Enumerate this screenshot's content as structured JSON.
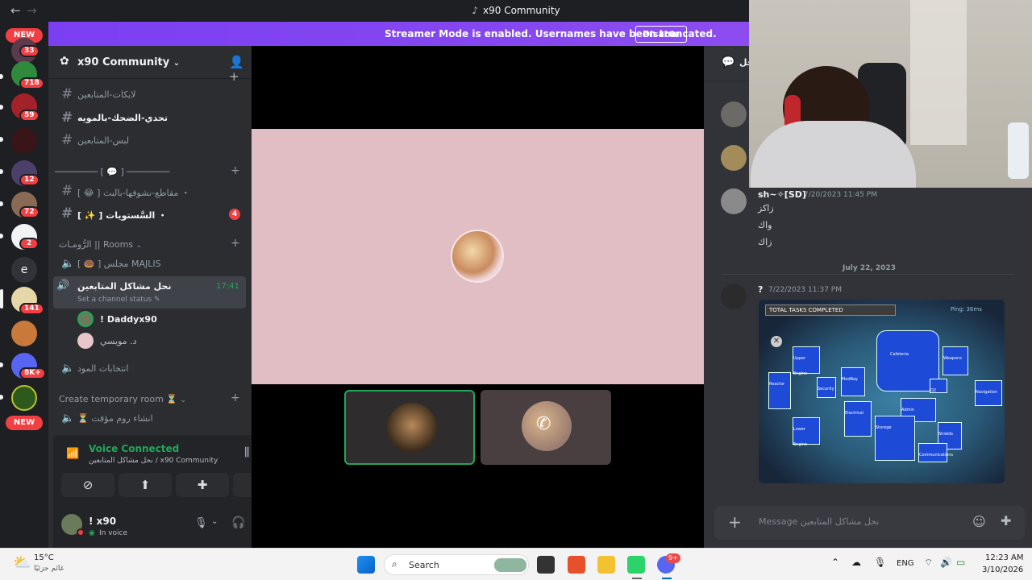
{
  "window": {
    "title": "x90 Community",
    "back": "←",
    "forward": "→"
  },
  "rail": {
    "new_label": "NEW",
    "badges": [
      "33",
      "718",
      "59",
      "12",
      "72",
      "2",
      "141",
      "8K+"
    ],
    "letter_server": "e"
  },
  "banner": {
    "message": "Streamer Mode is enabled. Usernames have been truncated.",
    "button": "Disable"
  },
  "sidebar": {
    "server_name": "x90 Community",
    "channels_top": [
      {
        "name": "لايكات-المتابعين"
      },
      {
        "name": "تحدي-الضحك-بالمويه",
        "unread": true
      },
      {
        "name": "لبس-المتابعين"
      }
    ],
    "category1": "──────── [ 💬 ] ────────",
    "channels_mid": [
      {
        "name": "[ 😂 ] مقاطع-نشوفها-بالبث ・"
      },
      {
        "name": "[ ✨ ] السَّستويات ・",
        "badge": "4",
        "unread": true
      }
    ],
    "category_rooms": "الرُّومـات || Rooms",
    "voice_channels": [
      {
        "name": "[ 🍩 ] مجلس MAJLIS"
      },
      {
        "name": "نحل مشاكل المتابعين",
        "time": "17:41",
        "status": "Set a channel status"
      }
    ],
    "members": [
      {
        "name": "! Daddyx90"
      },
      {
        "name": "د. مويسي"
      }
    ],
    "voice_channel_after": "انتخابات المود",
    "category_temp": "Create temporary room ⏳",
    "temp_channel": "⏳ انشاء روم مؤقت"
  },
  "voice_panel": {
    "status": "Voice Connected",
    "location": "نحل مشاكل المتابعين / x90 Community"
  },
  "user": {
    "name": "! x90",
    "status": "In voice"
  },
  "chat": {
    "header": "نحل",
    "messages": [
      {
        "author": "sh~✧[SD]",
        "time": "7/20/2023 11:45 PM",
        "lines": [
          "زاكز",
          "واك",
          "زاك"
        ]
      }
    ],
    "date_divider": "July 22, 2023",
    "message2": {
      "author": "?",
      "time": "7/22/2023 11:37 PM"
    },
    "map": {
      "title": "TOTAL TASKS COMPLETED",
      "ping": "Ping: 36ms",
      "rooms": [
        "Upper Engine",
        "Cafeteria",
        "Weapons",
        "MedBay",
        "Reactor",
        "Security",
        "Electrical",
        "Admin",
        "O2",
        "Navigation",
        "Lower Engine",
        "Storage",
        "Shields",
        "Communications"
      ]
    },
    "composer_placeholder": "Message نحل مشاكل المتابعين"
  },
  "taskbar": {
    "weather_temp": "15°C",
    "weather_desc": "غائم جزئيًا",
    "search": "Search",
    "lang": "ENG",
    "time": "12:23 AM",
    "date": "3/10/2026",
    "notification_badge": "9+"
  },
  "colors": {
    "accent": "#5865f2",
    "banner": "#7b3ff2",
    "online": "#23a55a",
    "danger": "#f23f43"
  }
}
